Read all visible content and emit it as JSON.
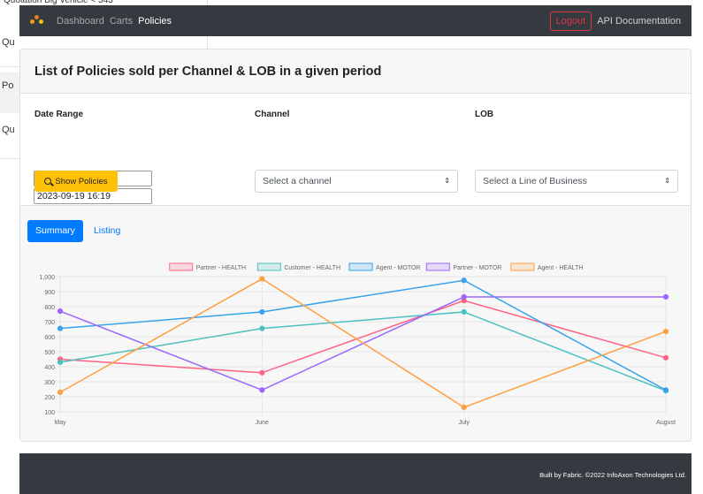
{
  "background": {
    "top_strip": "Quotation     Big Vehicle     < 343",
    "rows": [
      "Qu",
      "Po",
      "Qu"
    ]
  },
  "navbar": {
    "links": [
      "Dashboard",
      "Carts",
      "Policies"
    ],
    "active_link": "Policies",
    "logout_label": "Logout",
    "api_label": "API Documentation",
    "logo_icon": "fabric-logo-icon",
    "bg_color": "#343a40"
  },
  "card": {
    "title": "List of Policies sold per Channel & LOB in a given period",
    "date_range_label": "Date Range",
    "date_from": "2023-09-19 16:19",
    "date_to": "2023-09-19 16:19",
    "channel_label": "Channel",
    "channel_selected": "Select a channel",
    "lob_label": "LOB",
    "lob_selected": "Select a Line of Business",
    "show_button": "Show Policies",
    "show_button_icon": "search-icon",
    "show_button_color": "#ffc107"
  },
  "tabs": {
    "summary": "Summary",
    "listing": "Listing",
    "active": "Summary",
    "active_color": "#007bff"
  },
  "chart_data": {
    "type": "line",
    "categories": [
      "May",
      "June",
      "July",
      "August"
    ],
    "ylim": [
      100,
      1000
    ],
    "yticks": [
      "1,000",
      "900",
      "800",
      "700",
      "600",
      "500",
      "400",
      "300",
      "200",
      "100"
    ],
    "grid": true,
    "legend_position": "top",
    "series": [
      {
        "name": "Partner - HEALTH",
        "color": "#ff6384",
        "values": [
          450,
          360,
          840,
          460
        ]
      },
      {
        "name": "Customer - HEALTH",
        "color": "#4bc0c0",
        "values": [
          430,
          655,
          765,
          240
        ]
      },
      {
        "name": "Agent - MOTOR",
        "color": "#36a2eb",
        "values": [
          655,
          765,
          975,
          245
        ]
      },
      {
        "name": "Partner - MOTOR",
        "color": "#9966ff",
        "values": [
          770,
          245,
          865,
          865
        ]
      },
      {
        "name": "Agent - HEALTH",
        "color": "#ff9f40",
        "values": [
          230,
          985,
          130,
          635
        ]
      }
    ]
  },
  "footer": {
    "text": "Built by Fabric. ©2022 InfoAxon Technologies Ltd."
  }
}
